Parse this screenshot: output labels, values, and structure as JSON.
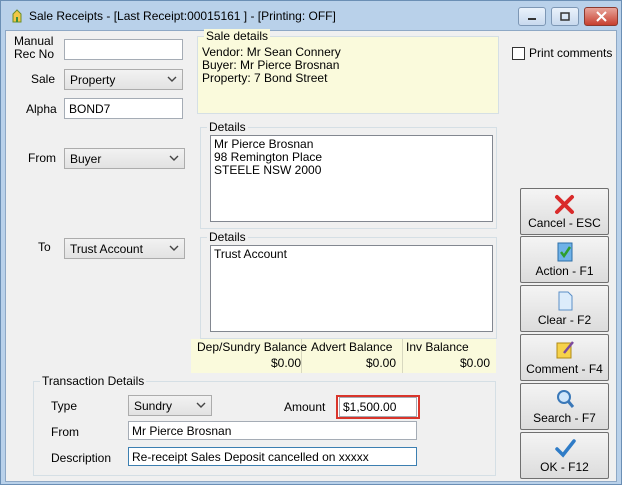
{
  "window": {
    "title": "Sale Receipts - [Last Receipt:00015161 ] - [Printing: OFF]"
  },
  "form": {
    "manual_rec_label": "Manual\nRec No",
    "manual_rec_label_1": "Manual",
    "manual_rec_label_2": "Rec No",
    "manual_rec_value": "",
    "sale_label": "Sale",
    "sale_value": "Property",
    "alpha_label": "Alpha",
    "alpha_value": "BOND7",
    "from_label": "From",
    "from_value": "Buyer",
    "to_label": "To",
    "to_value": "Trust Account"
  },
  "sale_details": {
    "title": "Sale details",
    "lines": [
      "Vendor: Mr Sean Connery",
      "Buyer: Mr Pierce Brosnan",
      "Property: 7 Bond Street"
    ]
  },
  "print_comments": {
    "label": "Print comments",
    "checked": false
  },
  "details_from": {
    "title": "Details",
    "lines": [
      "Mr Pierce Brosnan",
      "98 Remington Place",
      "STEELE  NSW  2000"
    ]
  },
  "details_to": {
    "title": "Details",
    "lines": [
      "Trust Account"
    ]
  },
  "balances": {
    "dep_label": "Dep/Sundry Balance",
    "dep_value": "$0.00",
    "advert_label": "Advert Balance",
    "advert_value": "$0.00",
    "inv_label": "Inv Balance",
    "inv_value": "$0.00"
  },
  "transaction": {
    "title": "Transaction Details",
    "type_label": "Type",
    "type_value": "Sundry",
    "amount_label": "Amount",
    "amount_value": "$1,500.00",
    "from_label": "From",
    "from_value": "Mr Pierce Brosnan",
    "description_label": "Description",
    "description_value": "Re-receipt Sales Deposit cancelled on xxxxx"
  },
  "buttons": {
    "cancel": "Cancel - ESC",
    "action": "Action - F1",
    "clear": "Clear - F2",
    "comment": "Comment - F4",
    "search": "Search - F7",
    "ok": "OK - F12"
  },
  "colors": {
    "highlight_border": "#d9352b",
    "yellow_panel": "#fafadc"
  }
}
